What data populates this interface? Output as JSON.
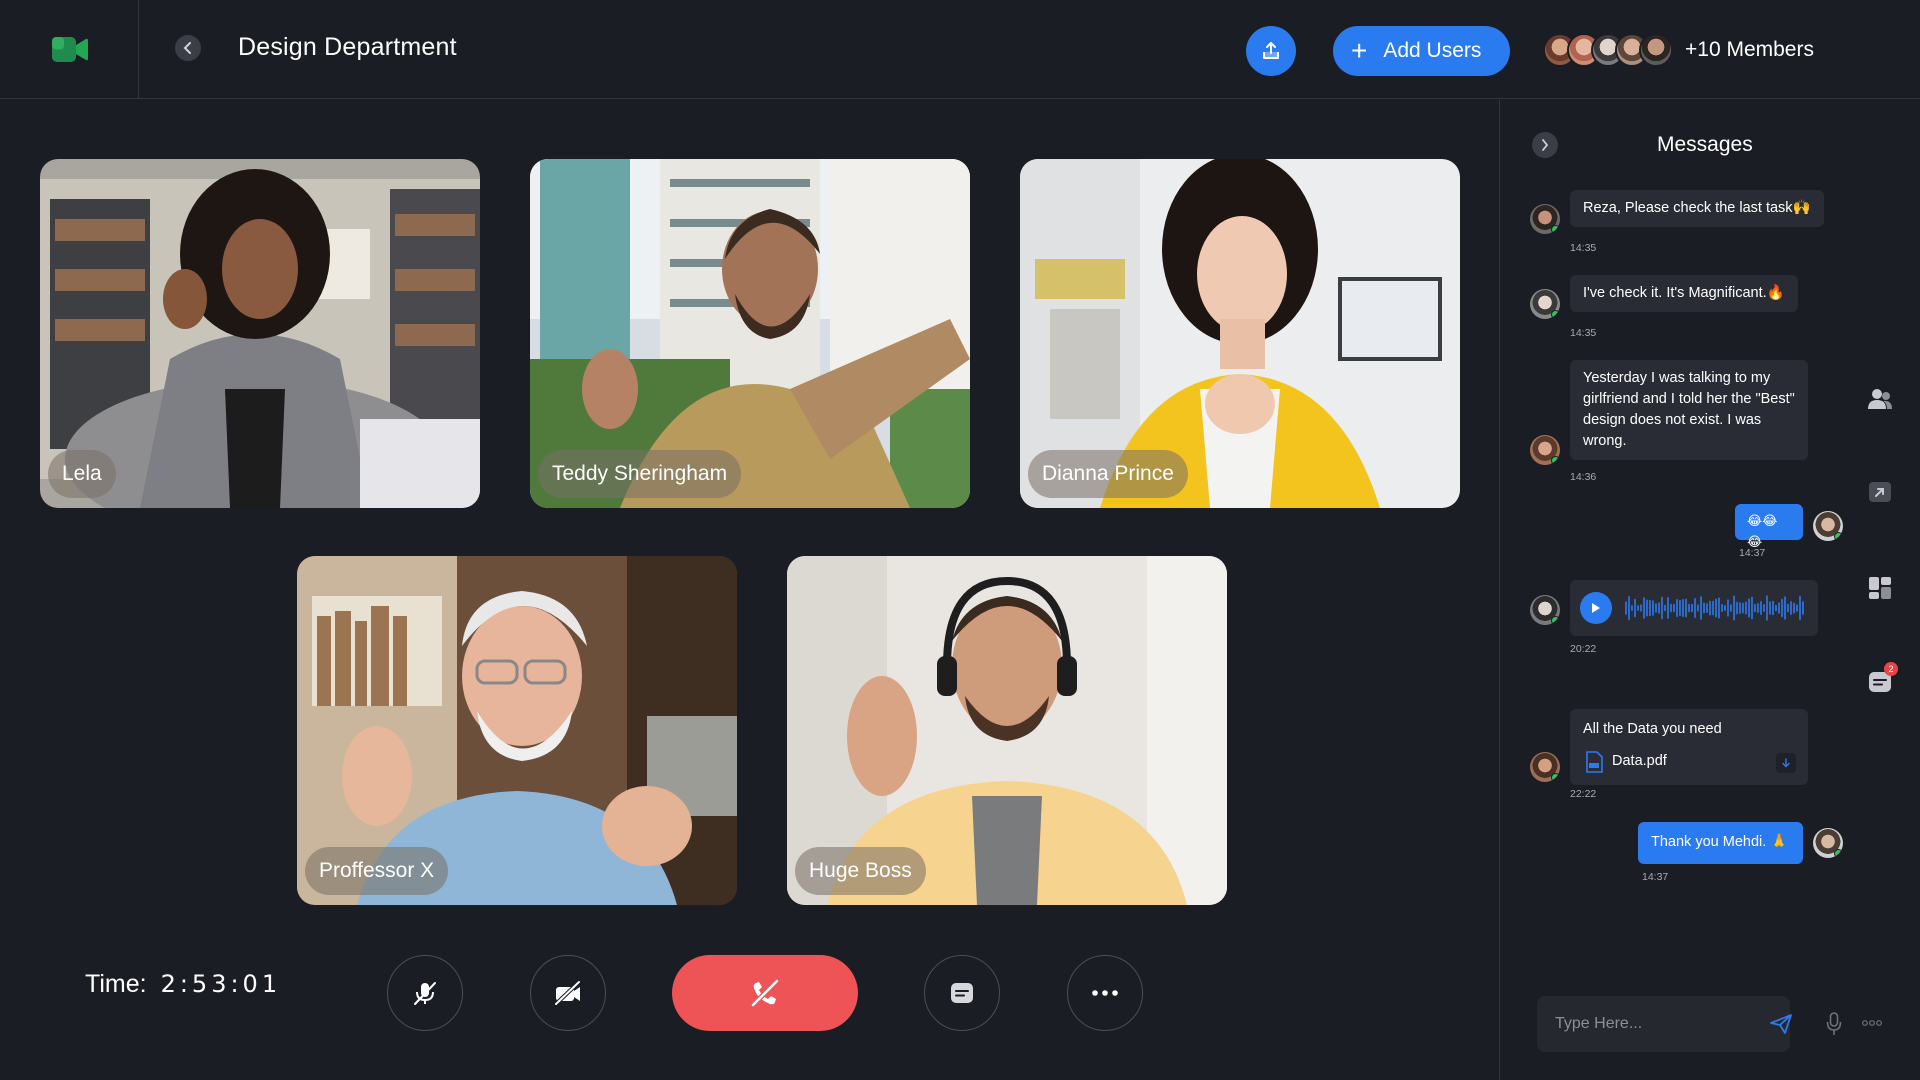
{
  "header": {
    "title": "Design Department",
    "add_users_label": "Add Users",
    "members_label": "+10 Members"
  },
  "participants": [
    {
      "name": "Lela"
    },
    {
      "name": "Teddy Sheringham"
    },
    {
      "name": "Dianna Prince"
    },
    {
      "name": "Proffessor X"
    },
    {
      "name": "Huge Boss"
    }
  ],
  "controls": {
    "time_label": "Time:",
    "time_value": "2:53:01"
  },
  "messages_panel": {
    "title": "Messages",
    "messages": [
      {
        "text": "Reza, Please check the last task🙌",
        "time": "14:35"
      },
      {
        "text": "I've check it. It's Magnificant.🔥",
        "time": "14:35"
      },
      {
        "text": "Yesterday I was talking to my girlfriend and I told her the \"Best\" design does not exist. I was wrong.",
        "time": "14:36"
      },
      {
        "text": "😂😂😂",
        "time": "14:37"
      },
      {
        "type": "voice",
        "time": "20:22"
      },
      {
        "text": "All the Data you need",
        "file": "Data.pdf",
        "time": "22:22"
      },
      {
        "text": "Thank you Mehdi. 🙏",
        "time": "14:37"
      }
    ],
    "badge_count": "2",
    "input_placeholder": "Type Here..."
  },
  "colors": {
    "background": "#1b1d25",
    "accent": "#2b7bf0",
    "danger": "#ee5356",
    "bubble": "#2a2c35",
    "online": "#33c35a"
  },
  "icons": [
    "meet-logo-icon",
    "back-chevron-icon",
    "share-upload-icon",
    "plus-icon",
    "mic-off-icon",
    "camera-off-icon",
    "end-call-icon",
    "chat-icon",
    "more-icon",
    "users-icon",
    "share-screen-icon",
    "grid-icon",
    "send-icon",
    "mic-icon"
  ]
}
